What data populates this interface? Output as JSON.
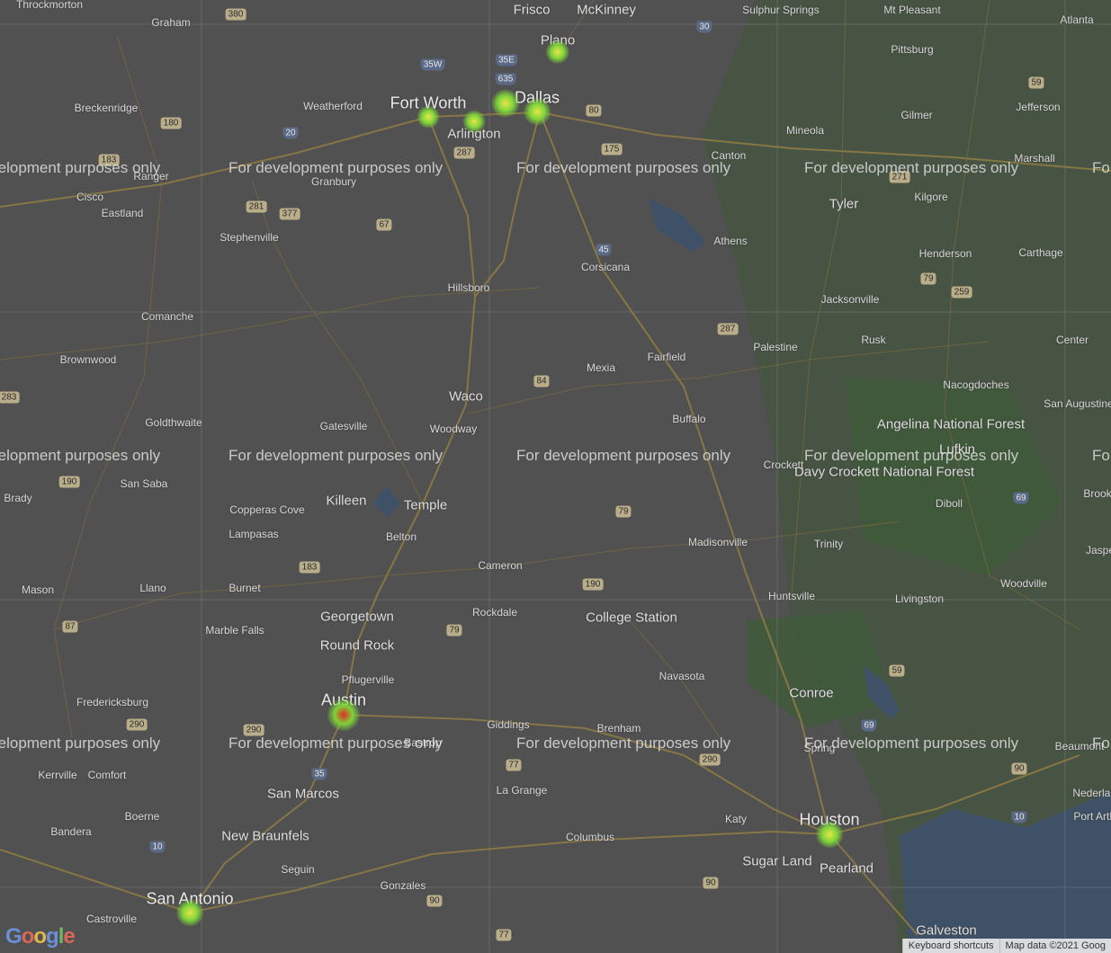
{
  "map": {
    "cities_major": [
      "Fort Worth",
      "Dallas",
      "Austin",
      "Houston",
      "San Antonio"
    ],
    "cities": [
      "Frisco",
      "McKinney",
      "Plano",
      "Arlington",
      "Waco",
      "Killeen",
      "Temple",
      "College Station",
      "Georgetown",
      "Round Rock",
      "San Marcos",
      "New Braunfels",
      "Conroe",
      "Tyler",
      "Sugar Land",
      "Pearland",
      "Galveston"
    ],
    "towns": [
      "Throckmorton",
      "Graham",
      "Sulphur Springs",
      "Mt Pleasant",
      "Atlanta",
      "Pittsburg",
      "Jefferson",
      "Breckenridge",
      "Weatherford",
      "Gilmer",
      "Mineola",
      "Marshall",
      "Canton",
      "Kilgore",
      "Cisco",
      "Ranger",
      "Granbury",
      "Eastland",
      "Stephenville",
      "Henderson",
      "Carthage",
      "Athens",
      "Corsicana",
      "Jacksonville",
      "Comanche",
      "Hillsboro",
      "Brownwood",
      "Palestine",
      "Rusk",
      "Center",
      "Mexia",
      "Fairfield",
      "Nacogdoches",
      "San Augustine",
      "Goldthwaite",
      "Gatesville",
      "Woodway",
      "Buffalo",
      "Brady",
      "San Saba",
      "Crockett",
      "Diboll",
      "Copperas Cove",
      "Lampasas",
      "Belton",
      "Madisonville",
      "Trinity",
      "Cameron",
      "Mason",
      "Llano",
      "Burnet",
      "Huntsville",
      "Livingston",
      "Woodville",
      "Rockdale",
      "Marble Falls",
      "Navasota",
      "Pflugerville",
      "Fredericksburg",
      "Giddings",
      "Brenham",
      "Bastrop",
      "Spring",
      "Beaumont",
      "Kerrville",
      "Comfort",
      "La Grange",
      "Boerne",
      "Bandera",
      "Katy",
      "Columbus",
      "Seguin",
      "Gonzales",
      "Castroville",
      "Nederland",
      "Port Arthur",
      "Jasper",
      "Brook"
    ],
    "forest_labels": [
      "Angelina National Forest",
      "Davy Crockett National Forest",
      "Lufkin"
    ],
    "shields": [
      "380",
      "30",
      "59",
      "35W",
      "35E",
      "635",
      "180",
      "80",
      "20",
      "287",
      "175",
      "271",
      "183",
      "281",
      "377",
      "67",
      "45",
      "79",
      "259",
      "84",
      "283",
      "190",
      "69",
      "287",
      "183",
      "79",
      "190",
      "87",
      "79",
      "290",
      "59",
      "290",
      "35",
      "77",
      "290",
      "69",
      "90",
      "10",
      "90",
      "90",
      "10",
      "77"
    ]
  },
  "overlay": {
    "watermark": "For development purposes only"
  },
  "heatmap": {
    "colors": {
      "low": "#7dd33a",
      "high": "#e32b1f"
    },
    "points": [
      {
        "name": "Plano",
        "intensity": 0.4
      },
      {
        "name": "Dallas",
        "intensity": 0.7
      },
      {
        "name": "Dallas East",
        "intensity": 0.6
      },
      {
        "name": "Fort Worth",
        "intensity": 0.3
      },
      {
        "name": "Arlington",
        "intensity": 0.3
      },
      {
        "name": "Austin",
        "intensity": 1.0
      },
      {
        "name": "Houston",
        "intensity": 0.6
      },
      {
        "name": "San Antonio",
        "intensity": 0.6
      }
    ]
  },
  "footer": {
    "logo": "Google",
    "keyboard_shortcuts": "Keyboard shortcuts",
    "map_data": "Map data ©2021 Goog"
  }
}
